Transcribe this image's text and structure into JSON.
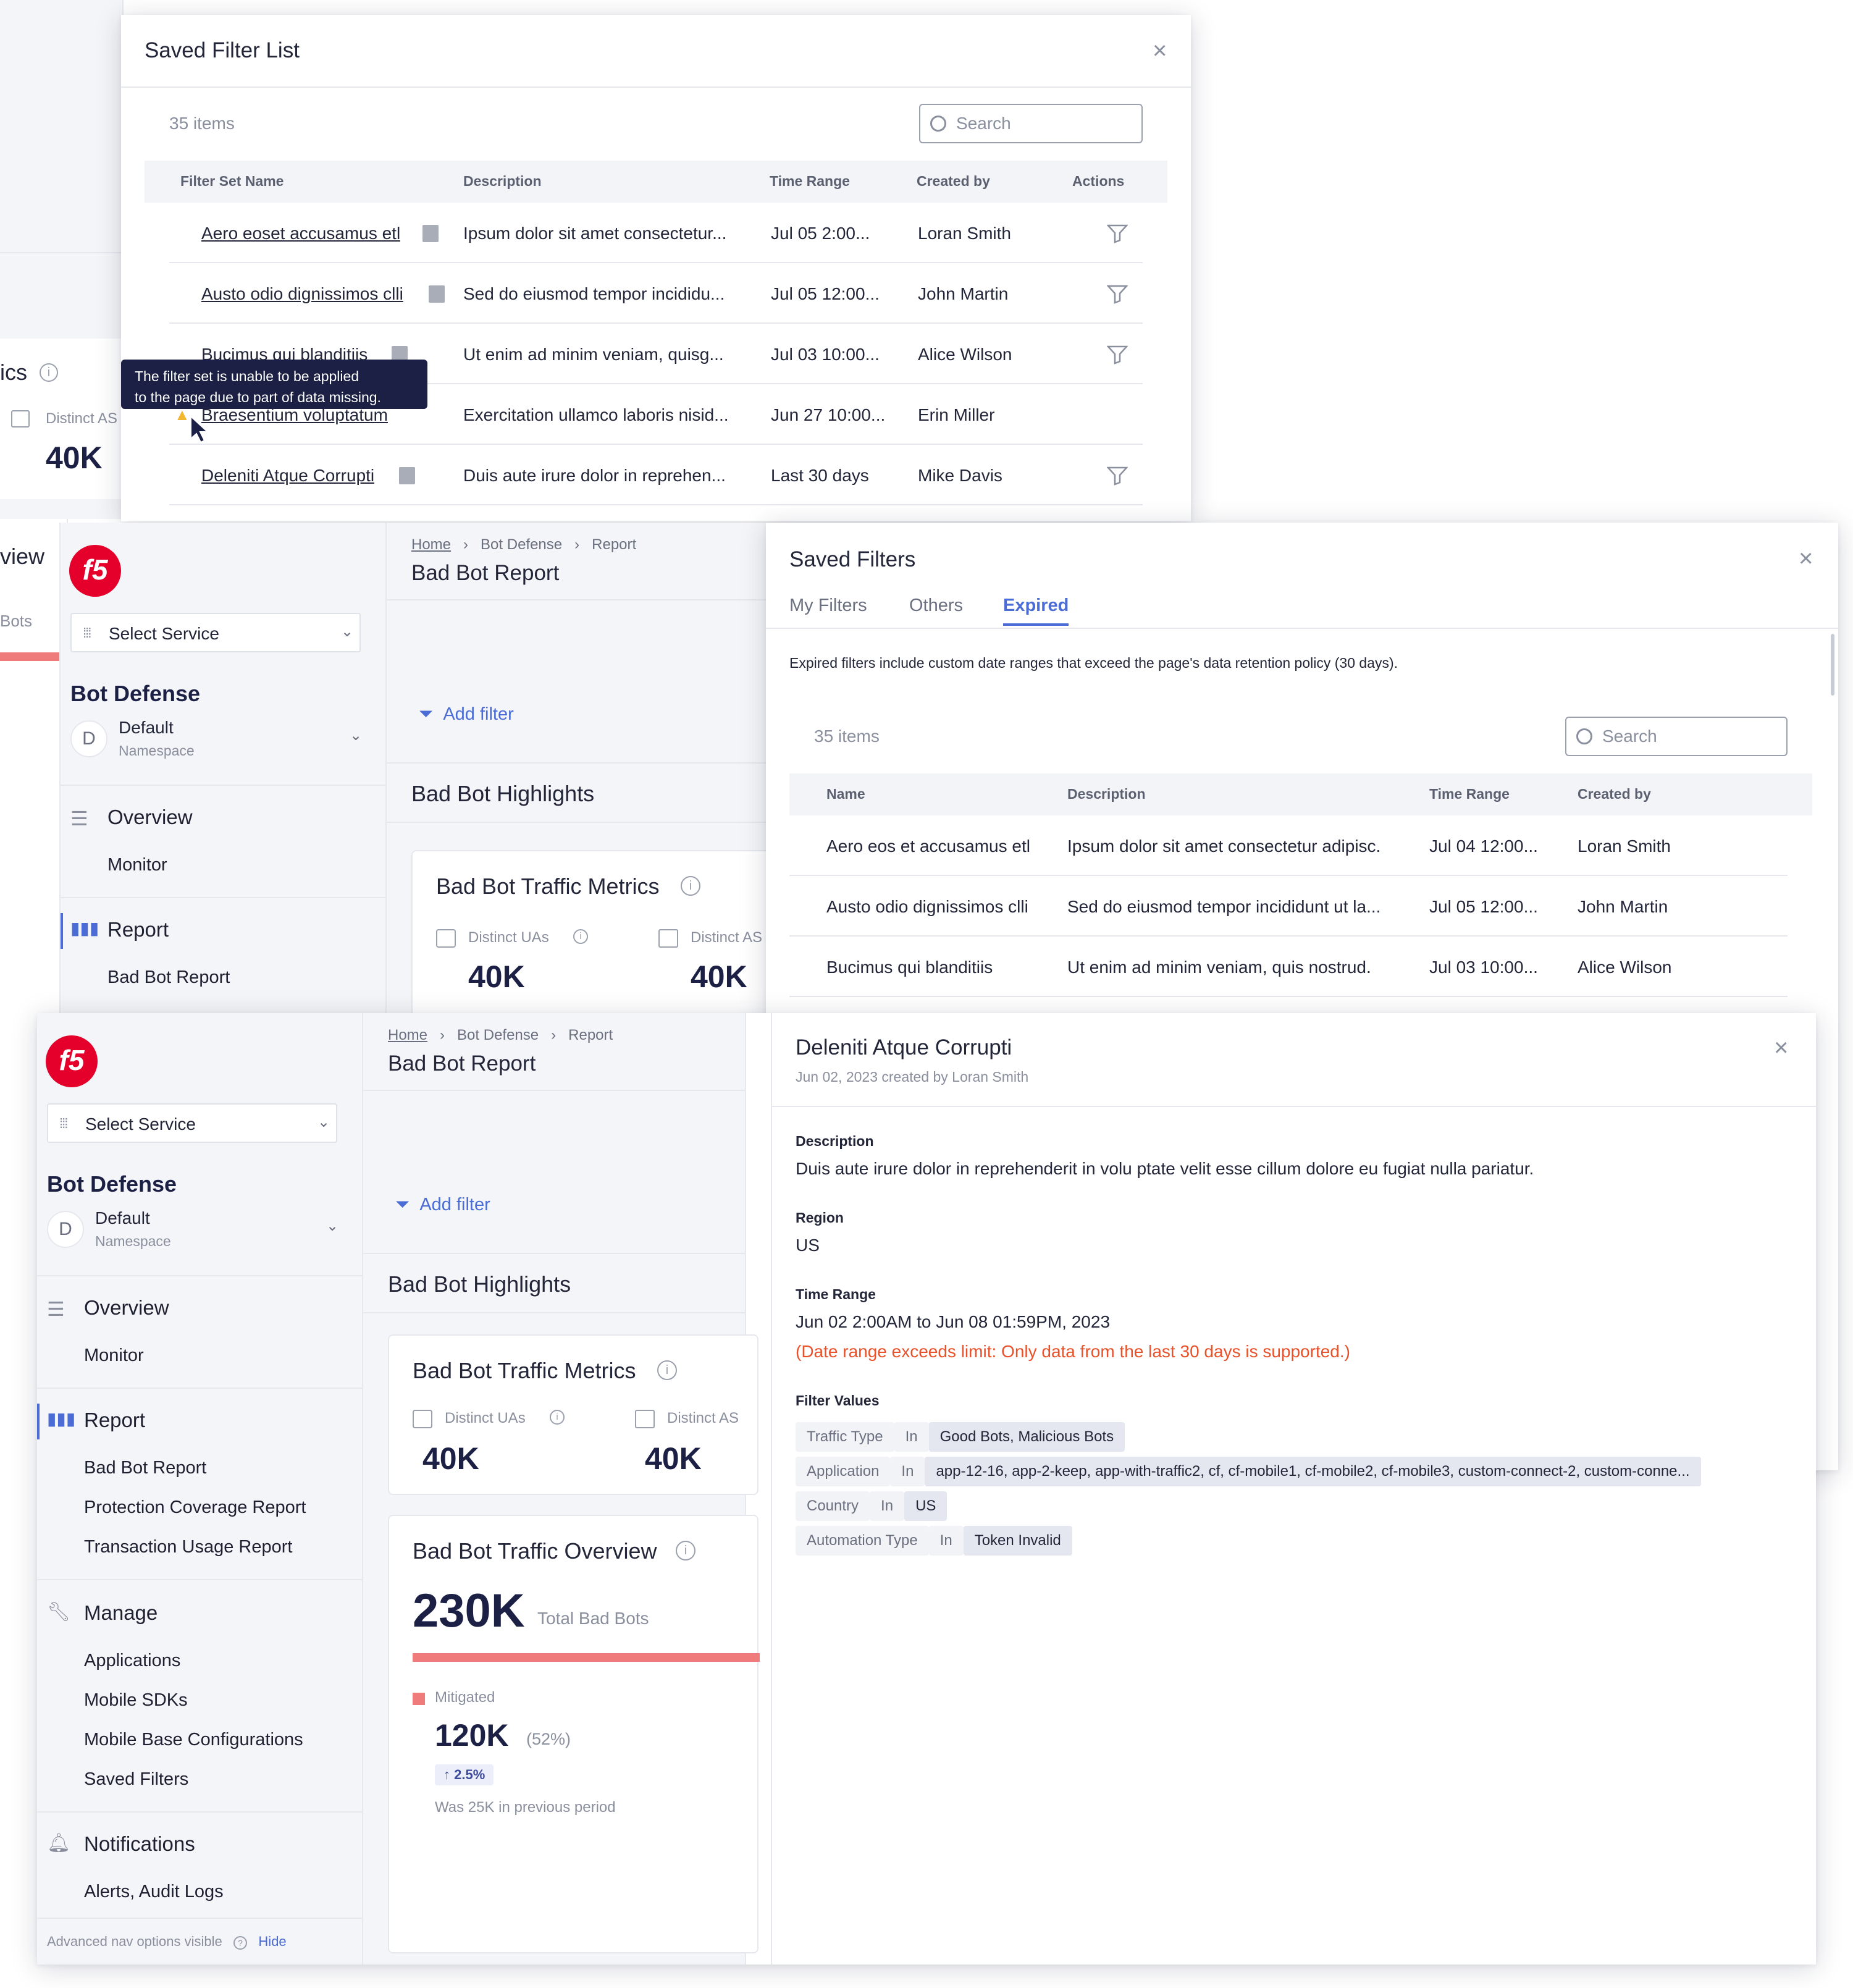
{
  "saved_filter_list": {
    "title": "Saved Filter List",
    "count": "35 items",
    "search_placeholder": "Search",
    "headers": [
      "Filter Set Name",
      "Description",
      "Time Range",
      "Created by",
      "Actions"
    ],
    "rows": [
      {
        "name": "Aero eoset accusamus etl",
        "desc": "Ipsum dolor sit amet consectetur...",
        "time": "Jul 05 2:00...",
        "by": "Loran Smith"
      },
      {
        "name": "Austo odio dignissimos clli",
        "desc": "Sed do eiusmod tempor incididu...",
        "time": "Jul 05 12:00...",
        "by": "John Martin"
      },
      {
        "name": "Bucimus qui blanditiis",
        "desc": "Ut enim ad minim veniam, quisg...",
        "time": "Jul 03 10:00...",
        "by": "Alice Wilson"
      },
      {
        "name": "Braesentium voluptatum",
        "desc": "Exercitation ullamco laboris nisid...",
        "time": "Jun 27 10:00...",
        "by": "Erin Miller"
      },
      {
        "name": "Deleniti Atque Corrupti",
        "desc": "Duis aute irure dolor in reprehen...",
        "time": "Last 30 days",
        "by": "Mike Davis"
      }
    ],
    "tooltip_line1": "The filter set is unable to be applied",
    "tooltip_line2": "to the page due to part of data missing."
  },
  "bg_left": {
    "metric_title_fragment": "ics",
    "metric_label": "Distinct AS",
    "metric_value": "40K",
    "overview_fragment": "view",
    "bots_fragment": "Bots"
  },
  "nav": {
    "logo": "f5",
    "select_service": "Select Service",
    "product": "Bot Defense",
    "ns_letter": "D",
    "ns_name": "Default",
    "ns_label": "Namespace",
    "overview": "Overview",
    "monitor": "Monitor",
    "report": "Report",
    "bad_bot_report": "Bad Bot Report",
    "protection_report": "Protection Coverage Report",
    "transaction_report": "Transaction Usage Report",
    "manage": "Manage",
    "applications": "Applications",
    "mobile_sdks": "Mobile SDKs",
    "mobile_base": "Mobile Base Configurations",
    "saved_filters": "Saved Filters",
    "notifications": "Notifications",
    "alerts": "Alerts, Audit Logs",
    "adv_text": "Advanced nav options visible",
    "hide": "Hide"
  },
  "main": {
    "bc_home": "Home",
    "bc_bot": "Bot Defense",
    "bc_report": "Report",
    "title": "Bad Bot Report",
    "add_filter": "Add filter",
    "highlights": "Bad Bot Highlights",
    "traffic_metrics": "Bad Bot Traffic Metrics",
    "distinct_uas": "Distinct UAs",
    "distinct_as": "Distinct AS",
    "uas_value": "40K",
    "as_value": "40K",
    "traffic_overview": "Bad Bot Traffic Overview",
    "total_value": "230K",
    "total_label": "Total Bad Bots",
    "mitigated": "Mitigated",
    "mitigated_value": "120K",
    "mitigated_pct": "(52%)",
    "delta": "2.5%",
    "prev": "Was 25K in previous period"
  },
  "saved_filters": {
    "title": "Saved Filters",
    "tabs": [
      "My Filters",
      "Others",
      "Expired"
    ],
    "active_tab": "Expired",
    "note": "Expired filters include custom date ranges that exceed the page's data retention policy (30 days).",
    "count": "35 items",
    "search_placeholder": "Search",
    "headers": [
      "Name",
      "Description",
      "Time Range",
      "Created by"
    ],
    "rows": [
      {
        "name": "Aero eos et accusamus etl",
        "desc": "Ipsum dolor sit amet consectetur adipisc.",
        "time": "Jul 04 12:00...",
        "by": "Loran Smith"
      },
      {
        "name": "Austo odio dignissimos clli",
        "desc": "Sed do eiusmod tempor incididunt ut la...",
        "time": "Jul 05 12:00...",
        "by": "John Martin"
      },
      {
        "name": "Bucimus qui blanditiis",
        "desc": "Ut enim ad minim veniam, quis nostrud.",
        "time": "Jul 03 10:00...",
        "by": "Alice Wilson"
      }
    ]
  },
  "detail": {
    "title": "Deleniti Atque Corrupti",
    "subtitle": "Jun 02, 2023 created by Loran Smith",
    "desc_label": "Description",
    "desc": "Duis aute irure dolor in reprehenderit in volu ptate velit esse cillum dolore eu fugiat nulla pariatur.",
    "region_label": "Region",
    "region": "US",
    "time_label": "Time Range",
    "time": "Jun 02 2:00AM to Jun 08 01:59PM, 2023",
    "warning": "(Date range exceeds limit: Only data from the last 30 days is supported.)",
    "fv_label": "Filter Values",
    "filters": [
      {
        "key": "Traffic Type",
        "op": "In",
        "val": "Good Bots, Malicious Bots"
      },
      {
        "key": "Application",
        "op": "In",
        "val": "app-12-16, app-2-keep, app-with-traffic2, cf, cf-mobile1, cf-mobile2, cf-mobile3, custom-connect-2, custom-conne..."
      },
      {
        "key": "Country",
        "op": "In",
        "val": "US"
      },
      {
        "key": "Automation Type",
        "op": "In",
        "val": "Token Invalid"
      }
    ]
  },
  "colors": {
    "accent": "#4a6cd4",
    "danger": "#e8512a",
    "bar": "#f07b7b",
    "navy": "#1b2044",
    "tooltip": "#1b2044"
  }
}
